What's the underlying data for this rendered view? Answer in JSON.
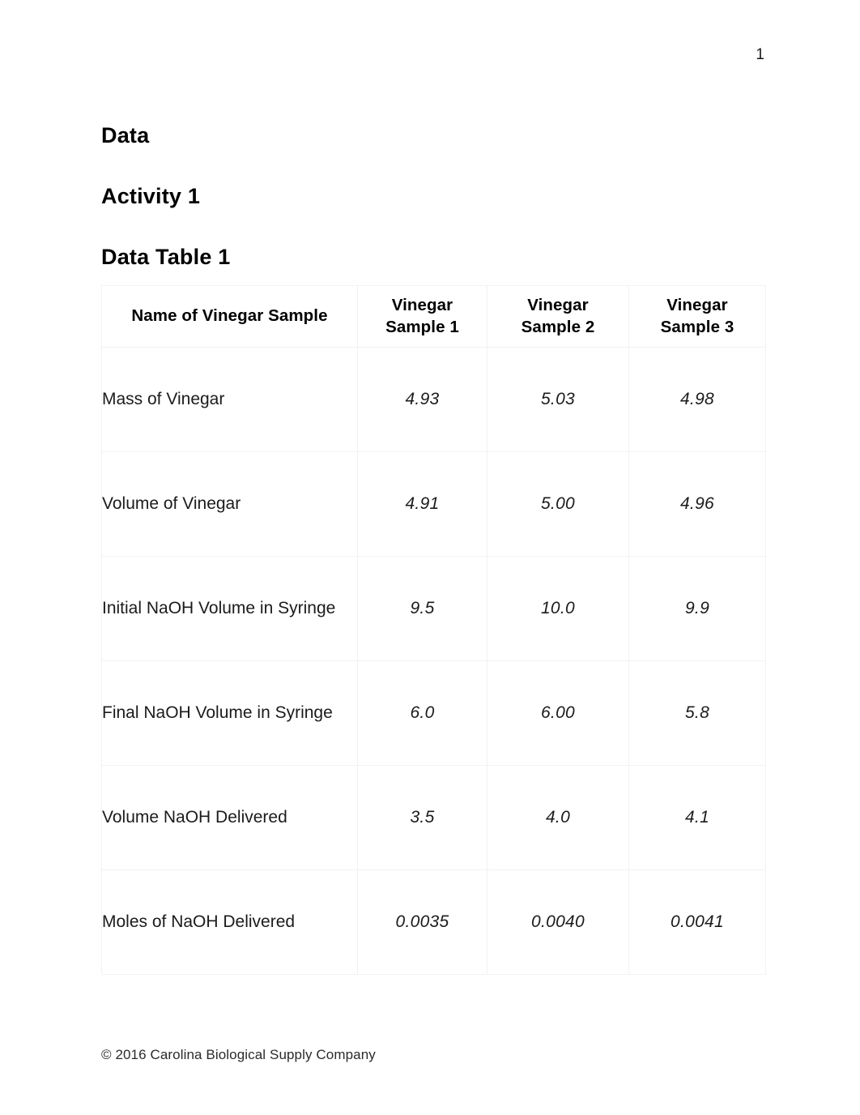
{
  "page": {
    "number": "1"
  },
  "headings": {
    "section": "Data",
    "activity": "Activity 1",
    "table_title": "Data Table 1"
  },
  "footer": {
    "copyright": "© 2016 Carolina Biological Supply Company"
  },
  "table": {
    "columns": [
      "Name of Vinegar Sample",
      "Vinegar Sample 1",
      "Vinegar Sample 2",
      "Vinegar Sample 3"
    ],
    "header_lines": {
      "label": "Name of Vinegar Sample",
      "s1_line1": "Vinegar",
      "s1_line2": "Sample 1",
      "s2_line1": "Vinegar",
      "s2_line2": "Sample 2",
      "s3_line1": "Vinegar",
      "s3_line2": "Sample 3"
    },
    "rows": [
      {
        "label": "Mass of Vinegar",
        "sample1": "4.93",
        "sample2": "5.03",
        "sample3": "4.98"
      },
      {
        "label": "Volume of Vinegar",
        "sample1": "4.91",
        "sample2": "5.00",
        "sample3": "4.96"
      },
      {
        "label": "Initial NaOH Volume in Syringe",
        "sample1": "9.5",
        "sample2": "10.0",
        "sample3": "9.9"
      },
      {
        "label": "Final NaOH Volume in Syringe",
        "sample1": "6.0",
        "sample2": "6.00",
        "sample3": "5.8"
      },
      {
        "label": "Volume NaOH Delivered",
        "sample1": "3.5",
        "sample2": "4.0",
        "sample3": "4.1"
      },
      {
        "label": "Moles of NaOH Delivered",
        "sample1": "0.0035",
        "sample2": "0.0040",
        "sample3": "0.0041"
      }
    ]
  },
  "colors": {
    "text": "#1b1b1b",
    "heading": "#000000",
    "border": "#f2f2f2",
    "background": "#ffffff"
  }
}
